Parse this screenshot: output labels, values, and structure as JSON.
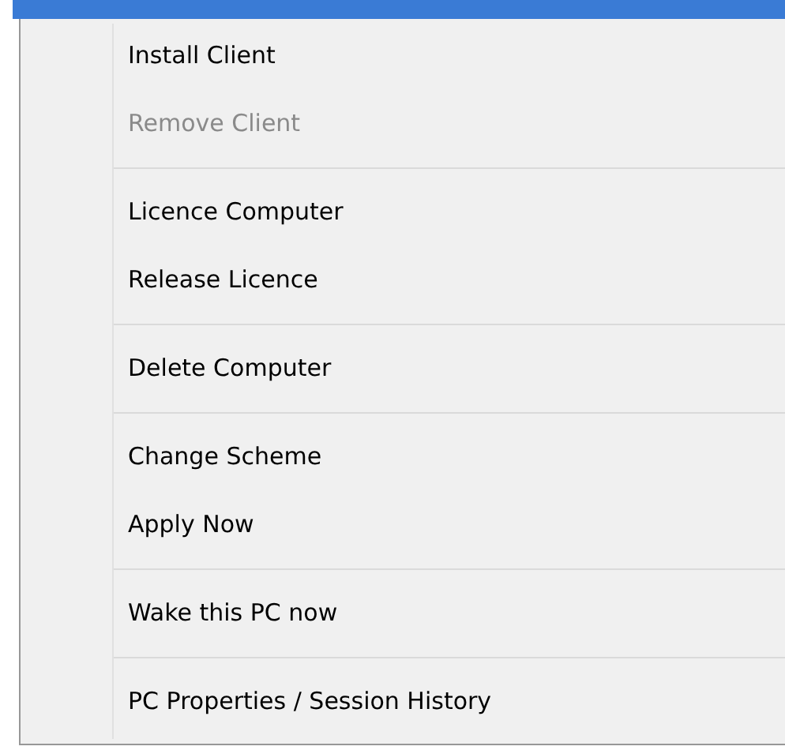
{
  "context_menu": {
    "groups": [
      {
        "items": [
          {
            "label": "Install Client",
            "disabled": false
          },
          {
            "label": "Remove Client",
            "disabled": true
          }
        ]
      },
      {
        "items": [
          {
            "label": "Licence Computer",
            "disabled": false
          },
          {
            "label": "Release Licence",
            "disabled": false
          }
        ]
      },
      {
        "items": [
          {
            "label": "Delete Computer",
            "disabled": false
          }
        ]
      },
      {
        "items": [
          {
            "label": "Change Scheme",
            "disabled": false
          },
          {
            "label": "Apply Now",
            "disabled": false
          }
        ]
      },
      {
        "items": [
          {
            "label": "Wake this PC now",
            "disabled": false
          }
        ]
      },
      {
        "items": [
          {
            "label": "PC Properties / Session History",
            "disabled": false
          }
        ]
      }
    ]
  }
}
